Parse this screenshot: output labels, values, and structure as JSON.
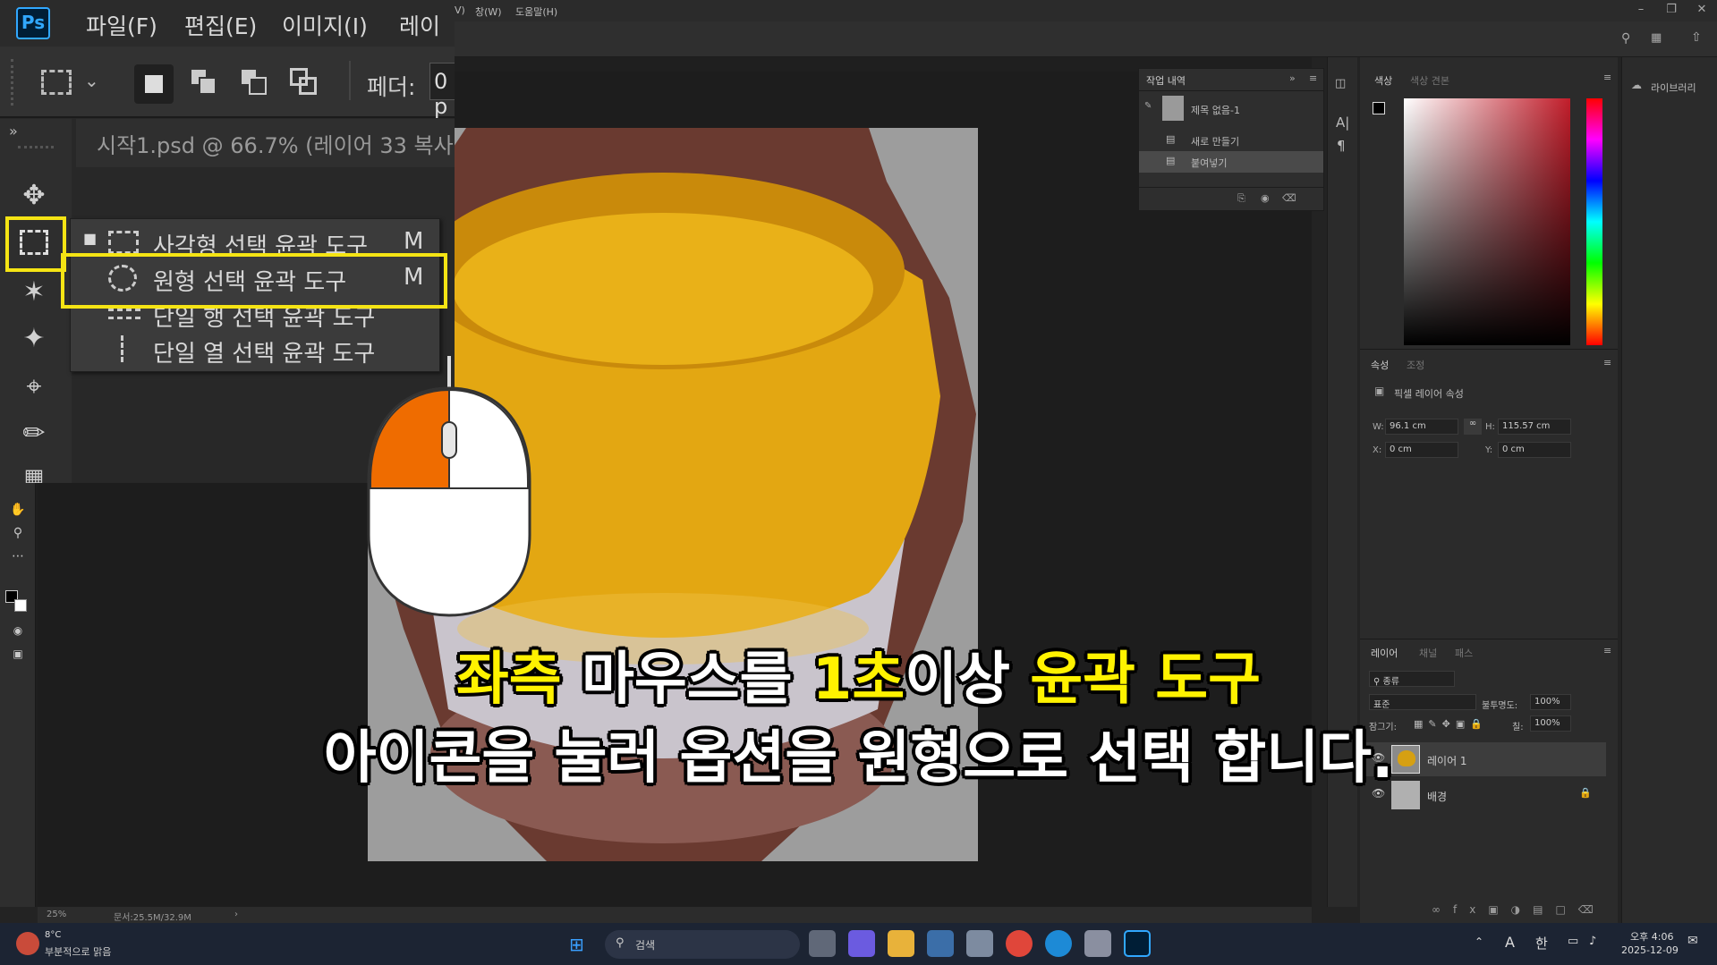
{
  "app": {
    "name": "Photoshop",
    "logo_text": "Ps",
    "menus": [
      "파일(F)",
      "편집(E)",
      "이미지(I)",
      "레이어"
    ],
    "menus_small": [
      "V)",
      "창(W)",
      "도움말(H)"
    ],
    "feather_label": "페더:",
    "feather_value": "0 p",
    "doc_tab": "시작1.psd @ 66.7% (레이어 33 복사"
  },
  "tool_flyout": {
    "items": [
      {
        "label": "사각형 선택 윤곽 도구",
        "key": "M",
        "active": true
      },
      {
        "label": "원형 선택 윤곽 도구",
        "key": "M",
        "highlighted": true
      },
      {
        "label": "단일 행 선택 윤곽 도구",
        "key": ""
      },
      {
        "label": "단일 열 선택 윤곽 도구",
        "key": ""
      }
    ]
  },
  "history_panel": {
    "tab": "작업 내역",
    "snapshot": "제목 없음-1",
    "items": [
      "새로 만들기",
      "붙여넣기"
    ]
  },
  "color_panel": {
    "tabs": [
      "색상",
      "색상 견본"
    ]
  },
  "properties_panel": {
    "tabs": [
      "속성",
      "조정"
    ],
    "title": "픽셀 레이어 속성",
    "w_label": "W:",
    "w_value": "96.1 cm",
    "h_label": "H:",
    "h_value": "115.57 cm",
    "x_label": "X:",
    "x_value": "0 cm",
    "y_label": "Y:",
    "y_value": "0 cm"
  },
  "layers_panel": {
    "tabs": [
      "레이어",
      "채널",
      "패스"
    ],
    "filter": "종류",
    "blend_mode": "표준",
    "opacity_label": "불투명도:",
    "opacity_value": "100%",
    "lock_label": "잠그기:",
    "fill_label": "칠:",
    "fill_value": "100%",
    "layers": [
      {
        "name": "레이어 1",
        "selected": true
      },
      {
        "name": "배경",
        "locked": true
      }
    ]
  },
  "libraries": {
    "label": "라이브러리"
  },
  "status_bar": {
    "zoom": "25%",
    "doc_info": "문서:25.5M/32.9M"
  },
  "caption": {
    "line1": [
      {
        "text": "좌측",
        "highlight": true
      },
      {
        "text": " 마우스를 ",
        "highlight": false
      },
      {
        "text": "1초",
        "highlight": true
      },
      {
        "text": "이상 ",
        "highlight": false
      },
      {
        "text": "윤곽 도구",
        "highlight": true
      }
    ],
    "line2": "아이콘을 눌러 옵션을 원형으로 선택 합니다."
  },
  "taskbar": {
    "weather_temp": "8°C",
    "weather_desc": "부분적으로 맑음",
    "search_placeholder": "검색",
    "ime_a": "A",
    "ime_lang": "한",
    "time": "오후 4:06",
    "date": "2025-12-09"
  },
  "colors": {
    "highlight_frame": "#f5e414",
    "caption_highlight": "#fff200",
    "mouse_left_button": "#ef6c00"
  }
}
